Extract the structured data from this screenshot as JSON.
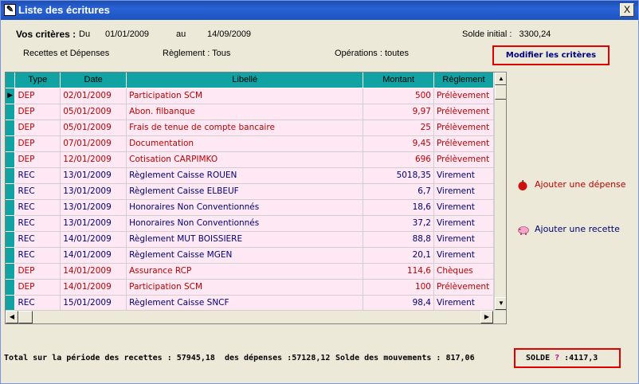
{
  "window": {
    "title": "Liste des écritures",
    "close_label": "X"
  },
  "criteria": {
    "label": "Vos critères :",
    "du_label": "Du",
    "date_from": "01/01/2009",
    "au_label": "au",
    "date_to": "14/09/2009",
    "solde_initial": "Solde initial :   3300,24",
    "type_filter": "Recettes et Dépenses",
    "reglement_filter": "Règlement : Tous",
    "operations_filter": "Opérations : toutes",
    "modify_button": "Modifier les critères"
  },
  "table": {
    "headers": [
      "Type",
      "Date",
      "Libellé",
      "Montant",
      "Règlement"
    ],
    "rows": [
      {
        "type": "DEP",
        "date": "02/01/2009",
        "libelle": "Participation SCM",
        "montant": "500",
        "reglement": "Prélèvement"
      },
      {
        "type": "DEP",
        "date": "05/01/2009",
        "libelle": "Abon. filbanque",
        "montant": "9,97",
        "reglement": "Prélèvement"
      },
      {
        "type": "DEP",
        "date": "05/01/2009",
        "libelle": "Frais de tenue de compte bancaire",
        "montant": "25",
        "reglement": "Prélèvement"
      },
      {
        "type": "DEP",
        "date": "07/01/2009",
        "libelle": "Documentation",
        "montant": "9,45",
        "reglement": "Prélèvement"
      },
      {
        "type": "DEP",
        "date": "12/01/2009",
        "libelle": "Cotisation CARPIMKO",
        "montant": "696",
        "reglement": "Prélèvement"
      },
      {
        "type": "REC",
        "date": "13/01/2009",
        "libelle": "Règlement Caisse ROUEN",
        "montant": "5018,35",
        "reglement": "Virement"
      },
      {
        "type": "REC",
        "date": "13/01/2009",
        "libelle": "Règlement Caisse ELBEUF",
        "montant": "6,7",
        "reglement": "Virement"
      },
      {
        "type": "REC",
        "date": "13/01/2009",
        "libelle": "Honoraires Non Conventionnés",
        "montant": "18,6",
        "reglement": "Virement"
      },
      {
        "type": "REC",
        "date": "13/01/2009",
        "libelle": "Honoraires Non Conventionnés",
        "montant": "37,2",
        "reglement": "Virement"
      },
      {
        "type": "REC",
        "date": "14/01/2009",
        "libelle": "Règlement MUT BOISSIERE",
        "montant": "88,8",
        "reglement": "Virement"
      },
      {
        "type": "REC",
        "date": "14/01/2009",
        "libelle": "Règlement Caisse MGEN",
        "montant": "20,1",
        "reglement": "Virement"
      },
      {
        "type": "DEP",
        "date": "14/01/2009",
        "libelle": "Assurance RCP",
        "montant": "114,6",
        "reglement": "Chèques"
      },
      {
        "type": "DEP",
        "date": "14/01/2009",
        "libelle": "Participation SCM",
        "montant": "100",
        "reglement": "Prélèvement"
      },
      {
        "type": "REC",
        "date": "15/01/2009",
        "libelle": "Règlement Caisse SNCF",
        "montant": "98,4",
        "reglement": "Virement"
      }
    ]
  },
  "actions": {
    "add_depense": "Ajouter une dépense",
    "add_recette": "Ajouter une recette"
  },
  "footer": {
    "totals": "Total sur la période des recettes : 57945,18  des dépenses :57128,12",
    "mouvements": "Solde des mouvements : 817,06",
    "solde_label": "SOLDE",
    "solde_icon": "?",
    "solde_value": ":4117,3"
  },
  "colors": {
    "dep": "#c00000",
    "rec": "#00007a",
    "header": "#11a3a3",
    "row_bg": "#fde8f4"
  }
}
